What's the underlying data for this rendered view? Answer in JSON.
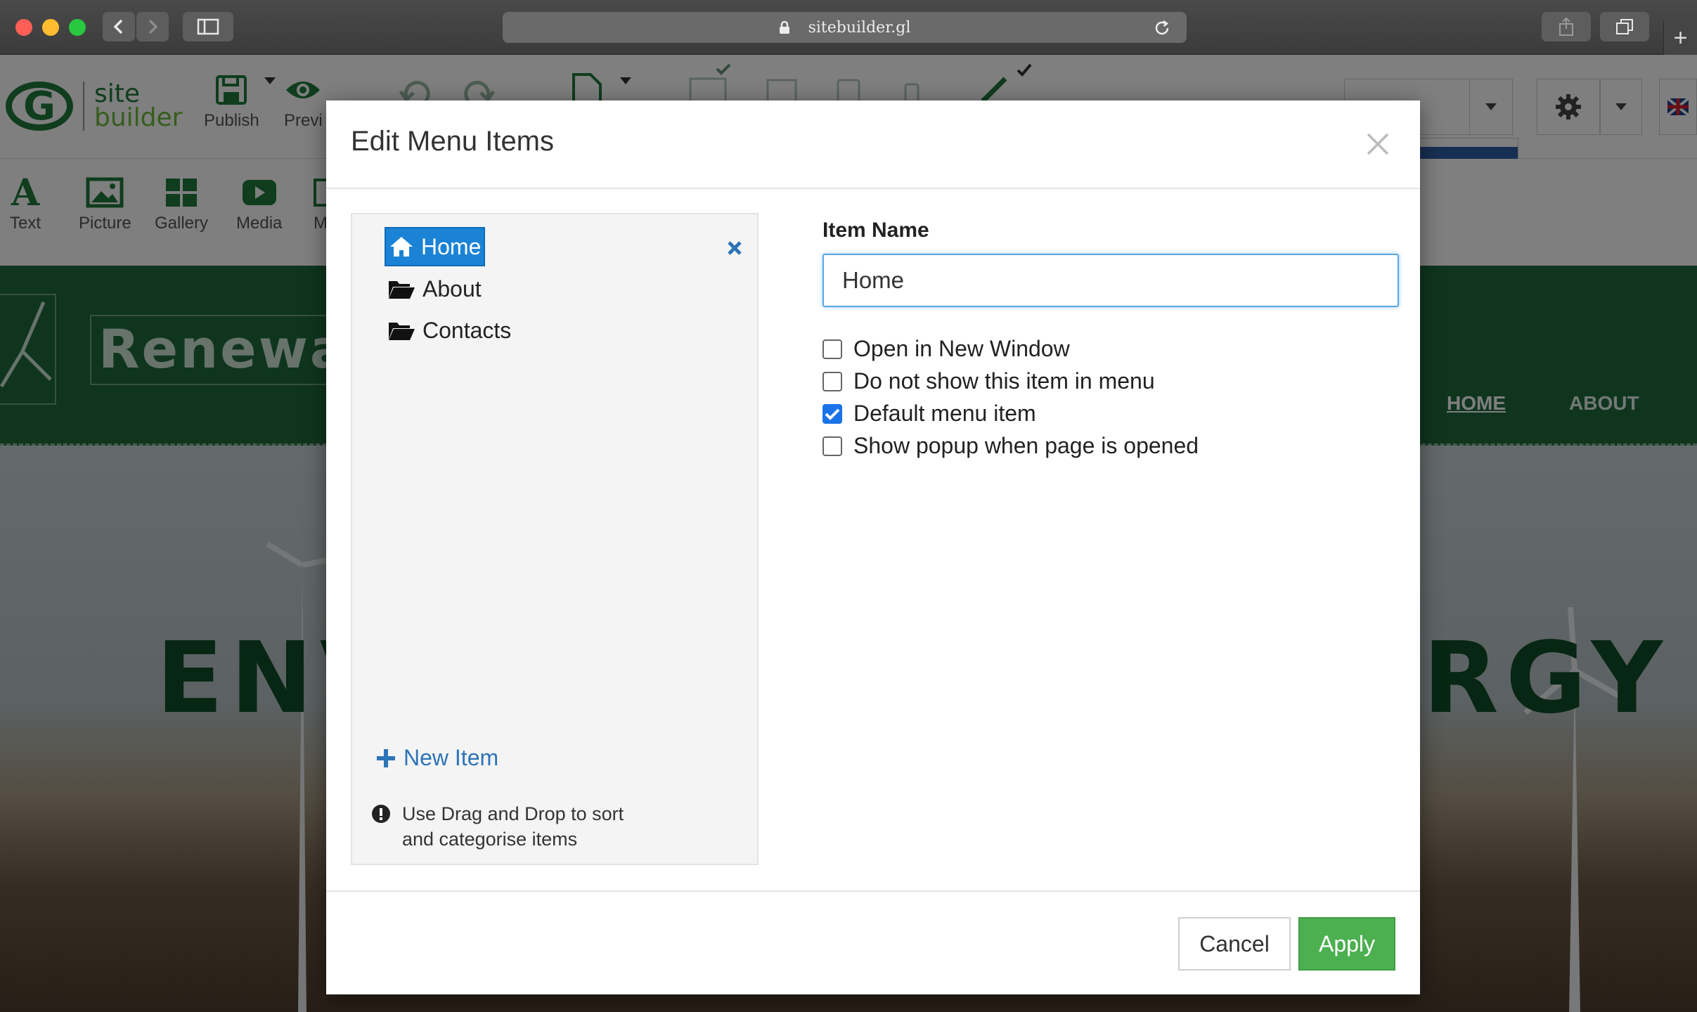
{
  "browser": {
    "url": "sitebuilder.gl"
  },
  "builder": {
    "logo": {
      "line1": "site",
      "line2": "builder"
    },
    "toolbar": {
      "publish_label": "Publish",
      "preview_label": "Previ"
    },
    "elements": {
      "text_label": "Text",
      "picture_label": "Picture",
      "gallery_label": "Gallery",
      "media_label": "Media",
      "more_label": "M"
    }
  },
  "site": {
    "brand": "Renewa",
    "nav": {
      "home": "HOME",
      "about": "ABOUT"
    },
    "hero_left": "ENV",
    "hero_right": "RGY"
  },
  "modal": {
    "title": "Edit Menu Items",
    "tree": [
      {
        "label": "Home",
        "icon": "home-icon",
        "selected": true
      },
      {
        "label": "About",
        "icon": "folder-open-icon",
        "selected": false
      },
      {
        "label": "Contacts",
        "icon": "folder-open-icon",
        "selected": false
      }
    ],
    "new_item_label": "New Item",
    "hint_line1": "Use Drag and Drop to sort",
    "hint_line2": "and categorise items",
    "item_name_label": "Item Name",
    "item_name_value": "Home",
    "options": [
      {
        "label": "Open in New Window",
        "checked": false
      },
      {
        "label": "Do not show this item in menu",
        "checked": false
      },
      {
        "label": "Default menu item",
        "checked": true
      },
      {
        "label": "Show popup when page is opened",
        "checked": false
      }
    ],
    "cancel_label": "Cancel",
    "apply_label": "Apply"
  },
  "colors": {
    "brand_green": "#1e6b3c",
    "selection_blue": "#1b83d6",
    "apply_green": "#4cb050",
    "link_blue": "#2d74b8"
  }
}
